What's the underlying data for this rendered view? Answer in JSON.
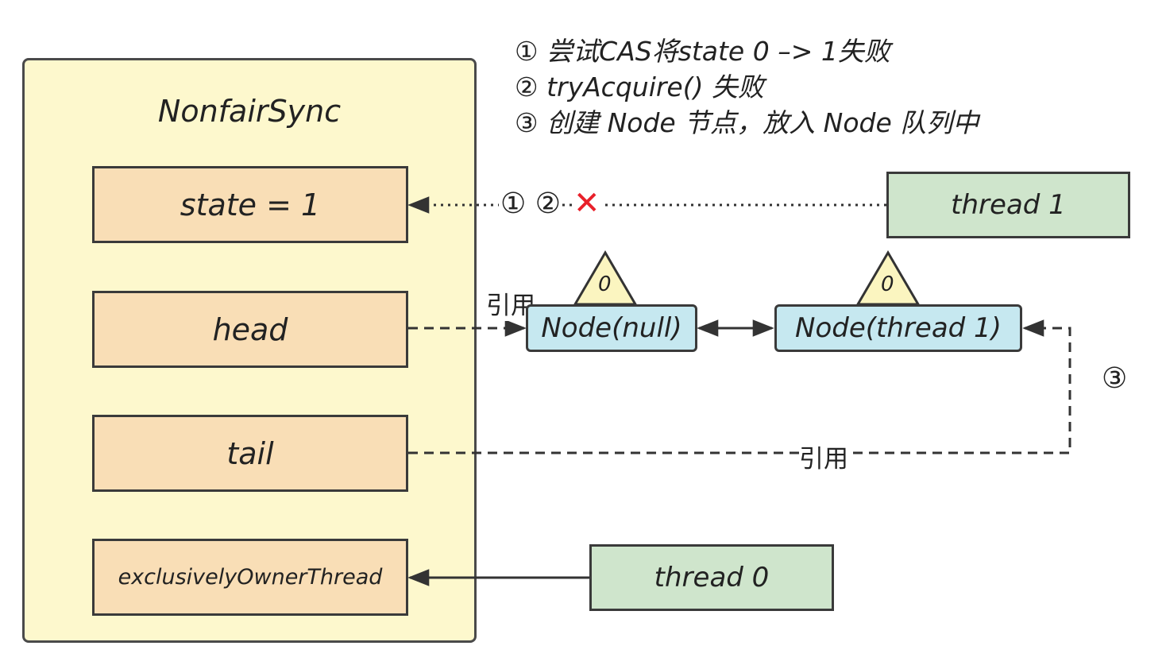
{
  "notes": [
    "① 尝试CAS将state 0 –> 1失败",
    "② tryAcquire() 失败",
    "③ 创建 Node 节点，放入 Node 队列中"
  ],
  "sync": {
    "title": "NonfairSync",
    "fields": {
      "state": "state = 1",
      "head": "head",
      "tail": "tail",
      "owner": "exclusivelyOwnerThread"
    }
  },
  "threads": {
    "t1": "thread 1",
    "t0": "thread 0"
  },
  "nodes": {
    "null_node": "Node(null)",
    "thread1_node": "Node(thread 1)",
    "null_node_wait": "0",
    "thread1_node_wait": "0"
  },
  "labels": {
    "head_ref": "引用",
    "tail_ref": "引用",
    "cas_steps": "① ②",
    "fail_mark": "✕",
    "enqueue_step": "③"
  },
  "colors": {
    "sync_bg": "#fdf8cd",
    "field_bg": "#f9deb6",
    "thread_bg": "#cfe5cc",
    "node_bg": "#c6e8f0",
    "fail_red": "#e8202a",
    "tri_bg": "#fbf5c0"
  }
}
